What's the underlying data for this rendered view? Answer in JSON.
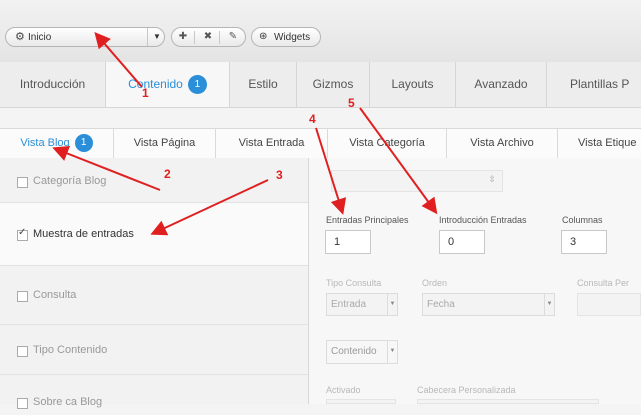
{
  "toolbar": {
    "inicio_select": "Inicio",
    "widgets_label": "Widgets",
    "icons": [
      "gear-icon",
      "plus-icon",
      "resize-icon",
      "pencil-icon",
      "widgets-icon"
    ]
  },
  "main_tabs": [
    {
      "label": "Introducción"
    },
    {
      "label": "Contenido",
      "badge": "1"
    },
    {
      "label": "Estilo"
    },
    {
      "label": "Gizmos"
    },
    {
      "label": "Layouts"
    },
    {
      "label": "Avanzado"
    },
    {
      "label": "Plantillas P"
    }
  ],
  "sub_tabs": [
    {
      "label": "Vista Blog",
      "badge": "1"
    },
    {
      "label": "Vista Página"
    },
    {
      "label": "Vista Entrada"
    },
    {
      "label": "Vista Categoría"
    },
    {
      "label": "Vista Archivo"
    },
    {
      "label": "Vista Etique"
    }
  ],
  "options": [
    {
      "label": "Categoría Blog",
      "checked": false
    },
    {
      "label": "Muestra de entradas",
      "checked": true
    },
    {
      "label": "Consulta",
      "checked": false
    },
    {
      "label": "Tipo Contenido",
      "checked": false
    },
    {
      "label": "Sobre ca Blog",
      "checked": false
    }
  ],
  "fields": {
    "entradas_principales": {
      "label": "Entradas Principales",
      "value": "1"
    },
    "introduccion_entradas": {
      "label": "Introducción Entradas",
      "value": "0"
    },
    "columnas": {
      "label": "Columnas",
      "value": "3"
    },
    "tipo_consulta": {
      "label": "Tipo Consulta",
      "value": "Entrada"
    },
    "orden": {
      "label": "Orden",
      "value": "Fecha"
    },
    "consulta_personalizada": {
      "label": "Consulta Per"
    },
    "tipo_contenido": {
      "value": "Contenido"
    },
    "activado": {
      "label": "Activado"
    },
    "cabecera": {
      "label": "Cabecera Personalizada"
    }
  },
  "annotations": [
    "1",
    "2",
    "3",
    "4",
    "5"
  ],
  "colors": {
    "accent": "#2a8fd8",
    "annotation": "#e02020"
  }
}
